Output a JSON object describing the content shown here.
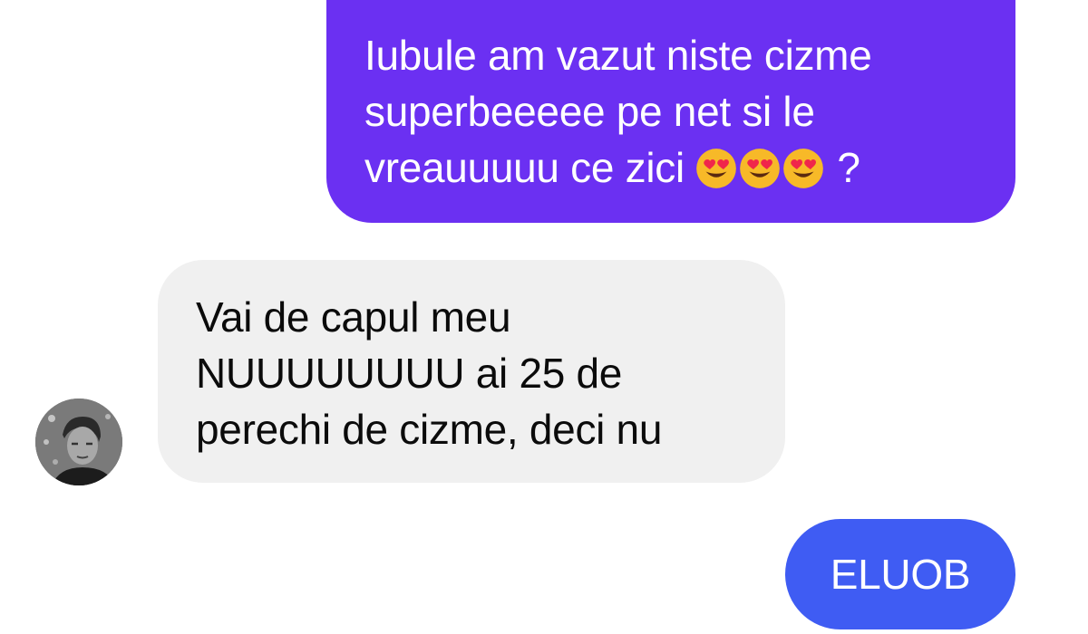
{
  "messages": {
    "sent_1": {
      "line1": "Iubule am vazut niste cizme",
      "line2": "superbeeeee pe net si le",
      "line3_text": "vreauuuuu ce zici",
      "line3_emojis": [
        "heart-eyes-emoji",
        "heart-eyes-emoji",
        "heart-eyes-emoji"
      ],
      "line3_end": "?"
    },
    "received_1": {
      "line1": "Vai de capul meu",
      "line2": "NUUUUUUUU ai 25 de",
      "line3": "perechi de cizme, deci nu"
    },
    "sent_2": {
      "text": "ELUOB"
    }
  },
  "colors": {
    "sent_bubble_1": "#6b30f2",
    "received_bubble": "#f0f0f0",
    "sent_bubble_2": "#3f5cf3"
  }
}
